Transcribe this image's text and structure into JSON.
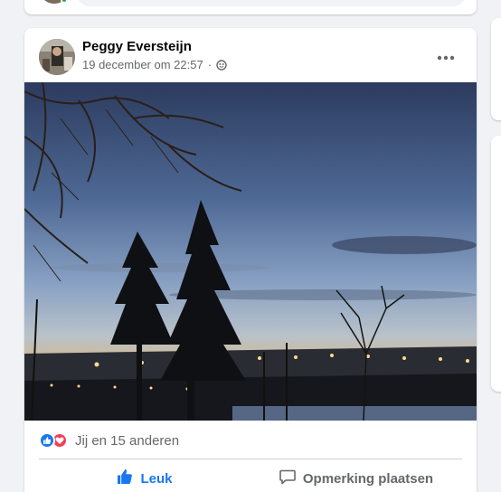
{
  "post": {
    "author": "Peggy Eversteijn",
    "date": "19 december om 22:57",
    "separator": "·",
    "privacy_icon": "globe-icon",
    "more_icon": "more-horizontal-icon"
  },
  "reactions": {
    "icons": [
      "like-reaction-icon",
      "love-reaction-icon"
    ],
    "summary": "Jij en 15 anderen"
  },
  "actions": {
    "like_label": "Leuk",
    "comment_label": "Opmerking plaatsen"
  },
  "colors": {
    "accent": "#1877f2",
    "love": "#f33e58",
    "online": "#31a24c",
    "secondary_text": "#65676b"
  }
}
